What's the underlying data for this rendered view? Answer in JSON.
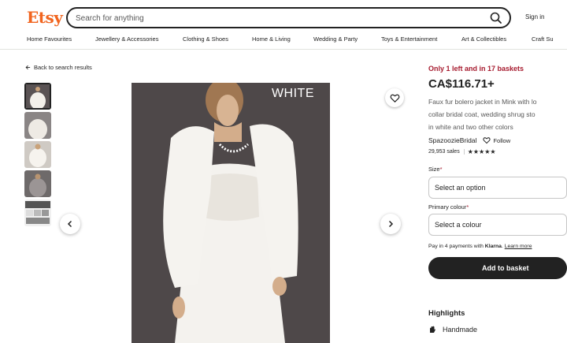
{
  "header": {
    "logo": "Etsy",
    "search_placeholder": "Search for anything",
    "signin": "Sign in"
  },
  "categories": [
    "Home Favourites",
    "Jewellery & Accessories",
    "Clothing & Shoes",
    "Home & Living",
    "Wedding & Party",
    "Toys & Entertainment",
    "Art & Collectibles",
    "Craft Su"
  ],
  "back_link": "Back to search results",
  "image": {
    "label": "WHITE",
    "thumbnail_count": 5,
    "active_thumbnail": 1
  },
  "product": {
    "stock_note": "Only 1 left and in 17 baskets",
    "price": "CA$116.71+",
    "title_lines": [
      "Faux fur bolero jacket in Mink with lo",
      "collar bridal coat, wedding shrug sto",
      "in white and two other colors"
    ],
    "shop_name": "SpazoozieBridal",
    "follow": "Follow",
    "sales": "29,953 sales",
    "stars": "★★★★★",
    "rating_stars": 4.5
  },
  "options": {
    "size_label": "Size",
    "size_value": "Select an option",
    "colour_label": "Primary colour",
    "colour_value": "Select a colour",
    "required_mark": "*"
  },
  "klarna": {
    "prefix": "Pay in 4 payments with ",
    "brand": "Klarna",
    "suffix": ". ",
    "link": "Learn more"
  },
  "basket_label": "Add to basket",
  "highlights": {
    "heading": "Highlights",
    "item": "Handmade"
  },
  "colors": {
    "brand": "#f1641e",
    "stock": "#a61a2e",
    "dark": "#222222",
    "image_bg": "#4e4849"
  }
}
